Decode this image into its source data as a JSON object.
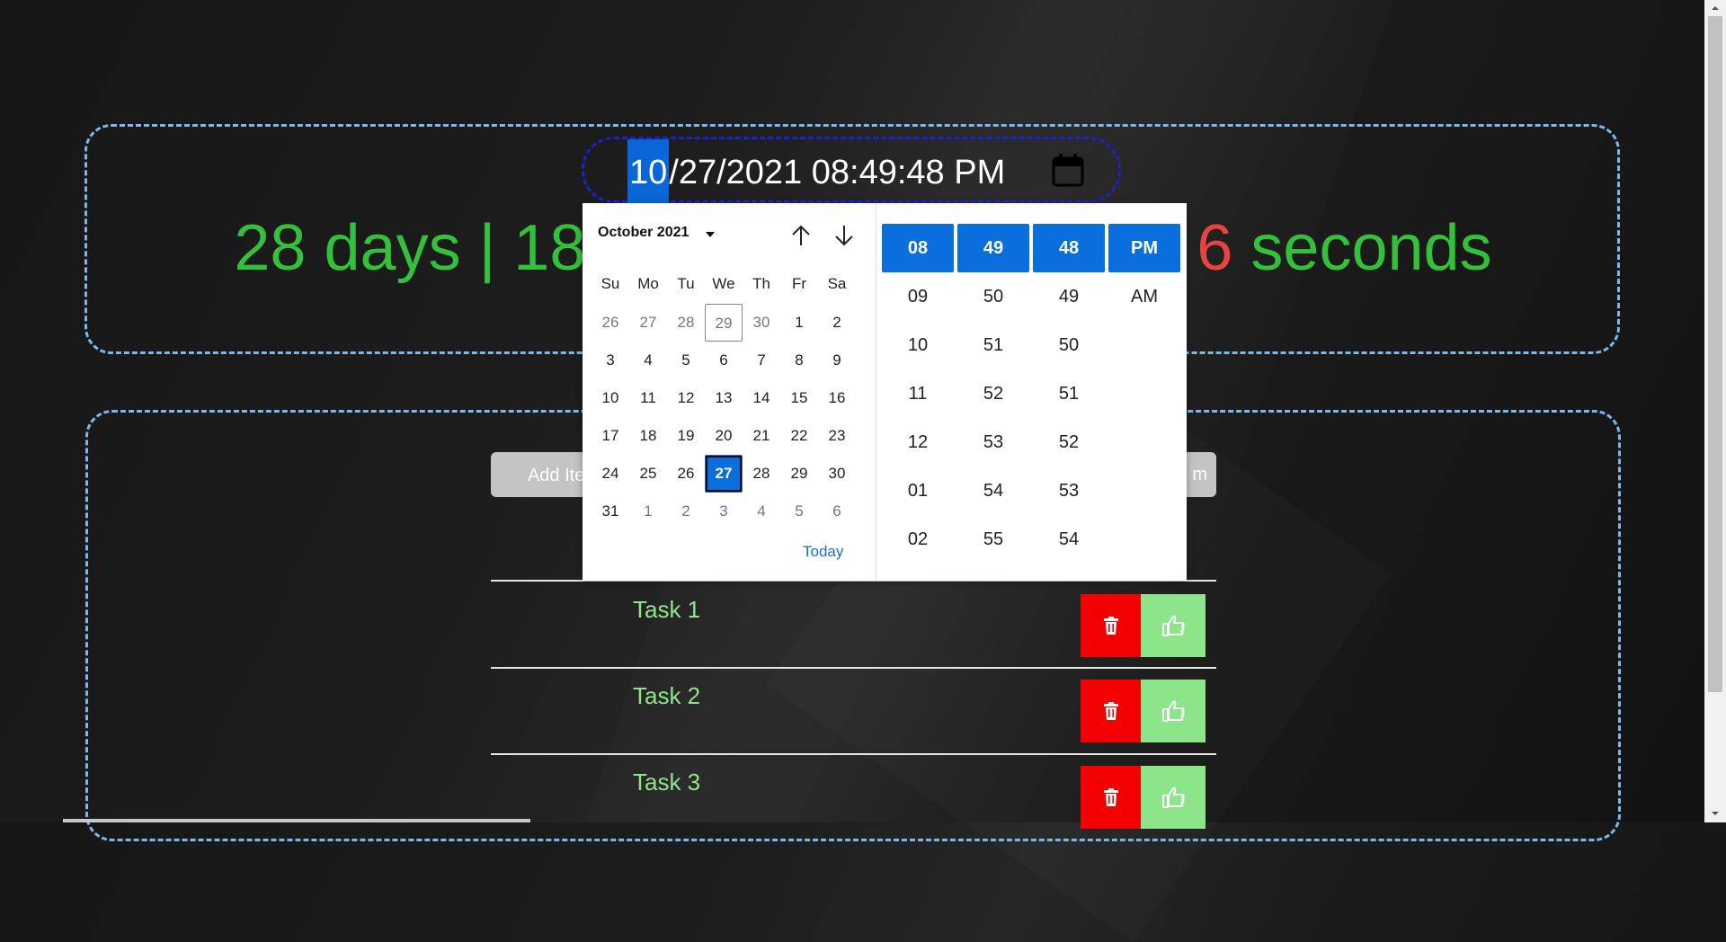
{
  "datetime": {
    "month": "10",
    "rest": "/27/2021 08:49:48 PM"
  },
  "countdown": {
    "left": "28 days | 18",
    "red": "6",
    "right": " seconds"
  },
  "todo": {
    "add_label": "Add Item",
    "right_label": "m",
    "tasks": [
      "Task 1",
      "Task 2",
      "Task 3"
    ]
  },
  "picker": {
    "month_label": "October 2021",
    "weekdays": [
      "Su",
      "Mo",
      "Tu",
      "We",
      "Th",
      "Fr",
      "Sa"
    ],
    "weeks": [
      [
        "26",
        "27",
        "28",
        "29",
        "30",
        "1",
        "2"
      ],
      [
        "3",
        "4",
        "5",
        "6",
        "7",
        "8",
        "9"
      ],
      [
        "10",
        "11",
        "12",
        "13",
        "14",
        "15",
        "16"
      ],
      [
        "17",
        "18",
        "19",
        "20",
        "21",
        "22",
        "23"
      ],
      [
        "24",
        "25",
        "26",
        "27",
        "28",
        "29",
        "30"
      ],
      [
        "31",
        "1",
        "2",
        "3",
        "4",
        "5",
        "6"
      ]
    ],
    "today_link": "Today",
    "hours": [
      "08",
      "09",
      "10",
      "11",
      "12",
      "01",
      "02"
    ],
    "minutes": [
      "49",
      "50",
      "51",
      "52",
      "53",
      "54",
      "55"
    ],
    "seconds": [
      "48",
      "49",
      "50",
      "51",
      "52",
      "53",
      "54"
    ],
    "ampm": [
      "PM",
      "AM"
    ]
  },
  "colors": {
    "accent": "#0a6edc",
    "countdown_green": "#33c13b",
    "countdown_red": "#e8433f",
    "task_green": "#8ee68b",
    "delete_red": "#f40000",
    "border_dashed": "#7ab8ef"
  }
}
